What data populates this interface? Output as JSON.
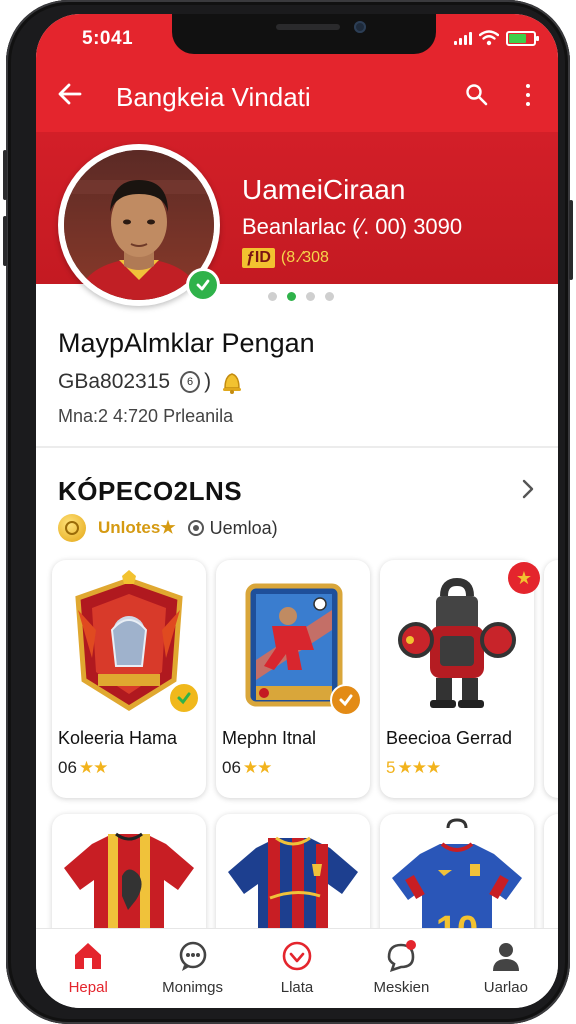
{
  "status": {
    "time": "5:041"
  },
  "appbar": {
    "title": "Bangkeia Vindati"
  },
  "hero": {
    "name": "UameiCiraan",
    "subtitle": "Beanlarlac (⁄. 00) 3090",
    "tag_chip": "ƒID",
    "tag_value": "(8.⁄308"
  },
  "profile": {
    "name": "MaypAlmklar Pengan",
    "id": "GBa802315",
    "id_coin": "6",
    "meta": "Mna:2 4:720 Prleanila"
  },
  "section": {
    "title": "KÓPECO2LNS",
    "filter_gold": "Unlotes★",
    "filter_option": "Uemloa)"
  },
  "cards": [
    {
      "title": "Koleeria Hama",
      "rating_num": "06",
      "stars": "★★"
    },
    {
      "title": "Mephn Itnal",
      "rating_num": "06",
      "stars": "★★"
    },
    {
      "title": "Beecioa Gerrad",
      "rating_num": "5",
      "stars": "★★★"
    }
  ],
  "jersey_number": "10",
  "bottomnav": [
    {
      "label": "Hepal",
      "icon": "home-icon",
      "active": true
    },
    {
      "label": "Monimgs",
      "icon": "chat-icon",
      "active": false
    },
    {
      "label": "Llata",
      "icon": "heart-icon",
      "active": false
    },
    {
      "label": "Meskien",
      "icon": "message-icon",
      "active": false
    },
    {
      "label": "Uarlao",
      "icon": "profile-icon",
      "active": false
    }
  ],
  "colors": {
    "brand_red": "#e4252d",
    "verified_green": "#2fb24a",
    "star_gold": "#f2b31c"
  }
}
